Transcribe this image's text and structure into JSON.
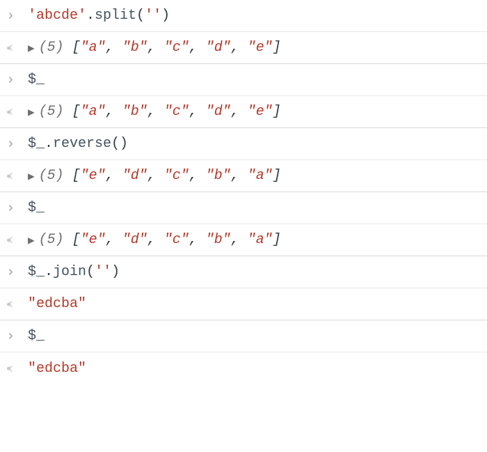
{
  "entries": [
    {
      "input": {
        "segments": [
          {
            "t": "'abcde'",
            "c": "str"
          },
          {
            "t": ".",
            "c": "punct"
          },
          {
            "t": "split",
            "c": "ident"
          },
          {
            "t": "(",
            "c": "punct"
          },
          {
            "t": "''",
            "c": "str"
          },
          {
            "t": ")",
            "c": "punct"
          }
        ]
      },
      "output": {
        "kind": "array",
        "len": 5,
        "items": [
          "\"a\"",
          "\"b\"",
          "\"c\"",
          "\"d\"",
          "\"e\""
        ]
      }
    },
    {
      "input": {
        "segments": [
          {
            "t": "$_",
            "c": "ident"
          }
        ]
      },
      "output": {
        "kind": "array",
        "len": 5,
        "items": [
          "\"a\"",
          "\"b\"",
          "\"c\"",
          "\"d\"",
          "\"e\""
        ]
      }
    },
    {
      "input": {
        "segments": [
          {
            "t": "$_",
            "c": "ident"
          },
          {
            "t": ".",
            "c": "punct"
          },
          {
            "t": "reverse",
            "c": "ident"
          },
          {
            "t": "()",
            "c": "punct"
          }
        ]
      },
      "output": {
        "kind": "array",
        "len": 5,
        "items": [
          "\"e\"",
          "\"d\"",
          "\"c\"",
          "\"b\"",
          "\"a\""
        ]
      }
    },
    {
      "input": {
        "segments": [
          {
            "t": "$_",
            "c": "ident"
          }
        ]
      },
      "output": {
        "kind": "array",
        "len": 5,
        "items": [
          "\"e\"",
          "\"d\"",
          "\"c\"",
          "\"b\"",
          "\"a\""
        ]
      }
    },
    {
      "input": {
        "segments": [
          {
            "t": "$_",
            "c": "ident"
          },
          {
            "t": ".",
            "c": "punct"
          },
          {
            "t": "join",
            "c": "ident"
          },
          {
            "t": "(",
            "c": "punct"
          },
          {
            "t": "''",
            "c": "str"
          },
          {
            "t": ")",
            "c": "punct"
          }
        ]
      },
      "output": {
        "kind": "string",
        "value": "\"edcba\""
      }
    },
    {
      "input": {
        "segments": [
          {
            "t": "$_",
            "c": "ident"
          }
        ]
      },
      "output": {
        "kind": "string",
        "value": "\"edcba\""
      }
    }
  ],
  "glyphs": {
    "input_prompt": "›",
    "output_prompt": "‹",
    "expand": "▶"
  }
}
